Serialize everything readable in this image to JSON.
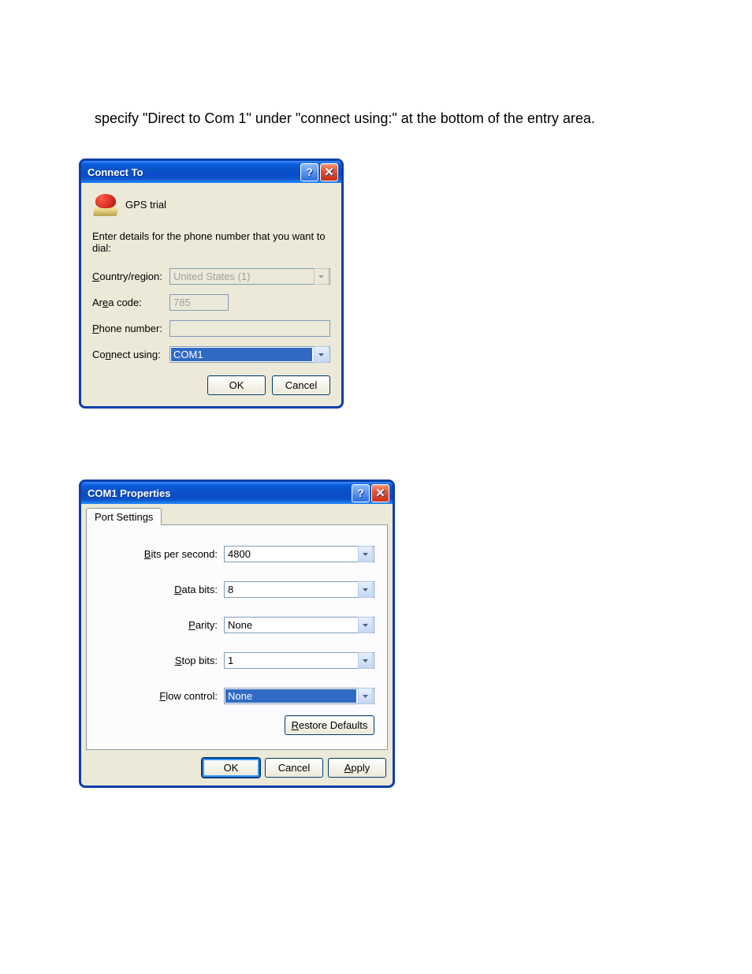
{
  "instruction_text": "specify \"Direct to Com 1\" under \"connect using:\" at the bottom of the entry area.",
  "dialog1": {
    "title": "Connect To",
    "connection_name": "GPS trial",
    "prompt": "Enter details for the phone number that you want to dial:",
    "labels": {
      "country": "Country/region:",
      "area": "Area code:",
      "phone": "Phone number:",
      "connect": "Connect using:"
    },
    "values": {
      "country": "United States (1)",
      "area": "785",
      "phone": "",
      "connect": "COM1"
    },
    "buttons": {
      "ok": "OK",
      "cancel": "Cancel"
    }
  },
  "dialog2": {
    "title": "COM1 Properties",
    "tab": "Port Settings",
    "labels": {
      "bps": "Bits per second:",
      "databits": "Data bits:",
      "parity": "Parity:",
      "stopbits": "Stop bits:",
      "flow": "Flow control:"
    },
    "values": {
      "bps": "4800",
      "databits": "8",
      "parity": "None",
      "stopbits": "1",
      "flow": "None"
    },
    "buttons": {
      "restore": "Restore Defaults",
      "ok": "OK",
      "cancel": "Cancel",
      "apply": "Apply"
    }
  }
}
